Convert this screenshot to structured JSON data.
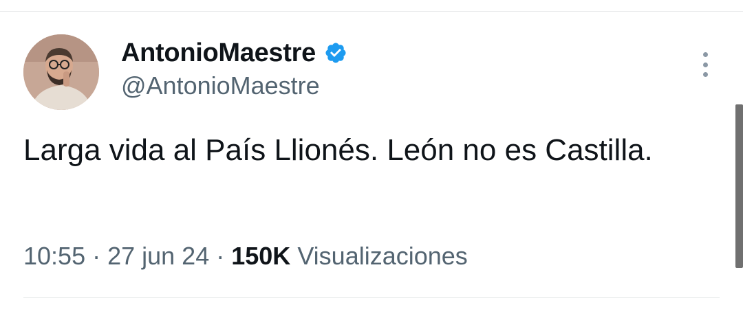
{
  "tweet": {
    "author": {
      "display_name": "AntonioMaestre",
      "handle": "@AntonioMaestre",
      "verified": true,
      "verified_icon": "verified-badge-icon",
      "verified_color": "#1d9bf0"
    },
    "text": "Larga vida al País Llionés. León no es Castilla.",
    "time": "10:55",
    "date": "27 jun 24",
    "separator": "·",
    "views_count": "150K",
    "views_label": "Visualizaciones"
  },
  "more_menu_icon": "more-vertical-icon",
  "colors": {
    "primary_text": "#0f1419",
    "secondary_text": "#536471",
    "divider": "#e7e9ea",
    "verified": "#1d9bf0"
  }
}
